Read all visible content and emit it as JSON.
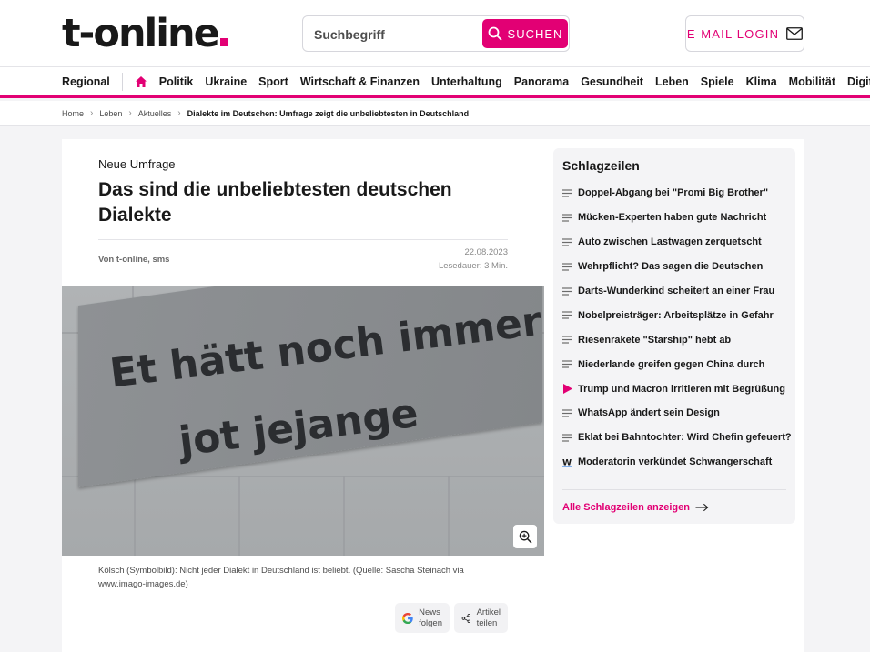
{
  "header": {
    "logo_text": "t-online",
    "search": {
      "placeholder": "Suchbegriff",
      "button_label": "SUCHEN"
    },
    "login_label": "E-MAIL LOGIN",
    "brand_color": "#e20074"
  },
  "nav": {
    "first": "Regional",
    "items": [
      "Politik",
      "Ukraine",
      "Sport",
      "Wirtschaft & Finanzen",
      "Unterhaltung",
      "Panorama",
      "Gesundheit",
      "Leben",
      "Spiele",
      "Klima",
      "Mobilität",
      "Digital"
    ]
  },
  "breadcrumb": {
    "items": [
      "Home",
      "Leben",
      "Aktuelles"
    ],
    "current": "Dialekte im Deutschen: Umfrage zeigt die unbeliebtesten in Deutschland"
  },
  "article": {
    "kicker": "Neue Umfrage",
    "headline": "Das sind die unbeliebtesten deutschen Dialekte",
    "author": "Von t-online, sms",
    "date": "22.08.2023",
    "read_time": "Lesedauer: 3 Min.",
    "image_text_line1": "Et hätt noch immer",
    "image_text_line2": "jot jejange",
    "caption": "Kölsch (Symbolbild): Nicht jeder Dialekt in Deutschland ist beliebt. (Quelle: Sascha Steinach via www.imago-images.de)",
    "google_follow_line1": "News",
    "google_follow_line2": "folgen",
    "share_line1": "Artikel",
    "share_line2": "teilen"
  },
  "sidebar": {
    "title": "Schlagzeilen",
    "items": [
      {
        "icon": "text-lines-icon",
        "label": "Doppel-Abgang bei \"Promi Big Brother\""
      },
      {
        "icon": "text-lines-icon",
        "label": "Mücken-Experten haben gute Nachricht"
      },
      {
        "icon": "text-lines-icon",
        "label": "Auto zwischen Lastwagen zerquetscht"
      },
      {
        "icon": "text-lines-icon",
        "label": "Wehrpflicht? Das sagen die Deutschen"
      },
      {
        "icon": "text-lines-icon",
        "label": "Darts-Wunderkind scheitert an einer Frau"
      },
      {
        "icon": "text-lines-icon",
        "label": "Nobelpreisträger: Arbeitsplätze in Gefahr"
      },
      {
        "icon": "text-lines-icon",
        "label": "Riesenrakete \"Starship\" hebt ab"
      },
      {
        "icon": "text-lines-icon",
        "label": "Niederlande greifen gegen China durch"
      },
      {
        "icon": "play-icon",
        "label": "Trump und Macron irritieren mit Begrüßung"
      },
      {
        "icon": "text-lines-icon",
        "label": "WhatsApp ändert sein Design"
      },
      {
        "icon": "text-lines-icon",
        "label": "Eklat bei Bahntochter: Wird Chefin gefeuert?"
      },
      {
        "icon": "w-logo-icon",
        "label": "Moderatorin verkündet Schwangerschaft"
      }
    ],
    "more_label": "Alle Schlagzeilen anzeigen"
  }
}
